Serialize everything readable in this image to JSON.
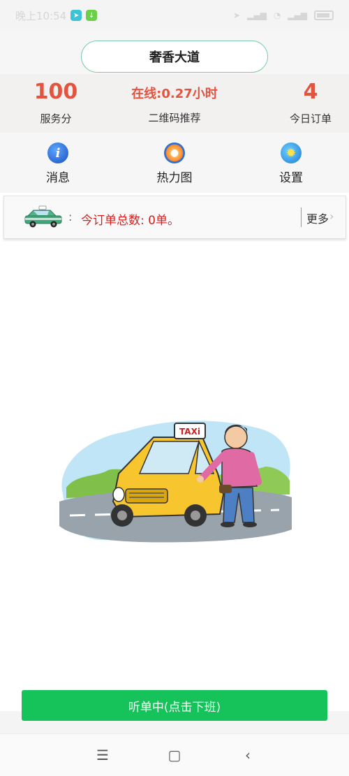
{
  "status_bar": {
    "time": "晚上10:54",
    "apps": [
      "navigation-app-icon",
      "download-app-icon"
    ]
  },
  "header": {
    "location": "奢香大道"
  },
  "stats": {
    "score_value": "100",
    "score_label": "服务分",
    "online_value": "在线:0.27小时",
    "qr_label": "二维码推荐",
    "orders_value": "4",
    "orders_label": "今日订单"
  },
  "menu": {
    "messages": "消息",
    "heatmap": "热力图",
    "settings": "设置"
  },
  "notice": {
    "colon": ":",
    "text": "今订单总数: 0单。",
    "more": "更多",
    "chevron": "›"
  },
  "illustration": {
    "sign": "TAXi"
  },
  "bottom": {
    "button_label": "听单中(点击下班)"
  },
  "nav": {
    "menu": "☰",
    "home": "▢",
    "back": "‹"
  },
  "colors": {
    "accent_red": "#e2543f",
    "accent_green": "#16c35a",
    "notice_red": "#d81f1f"
  }
}
